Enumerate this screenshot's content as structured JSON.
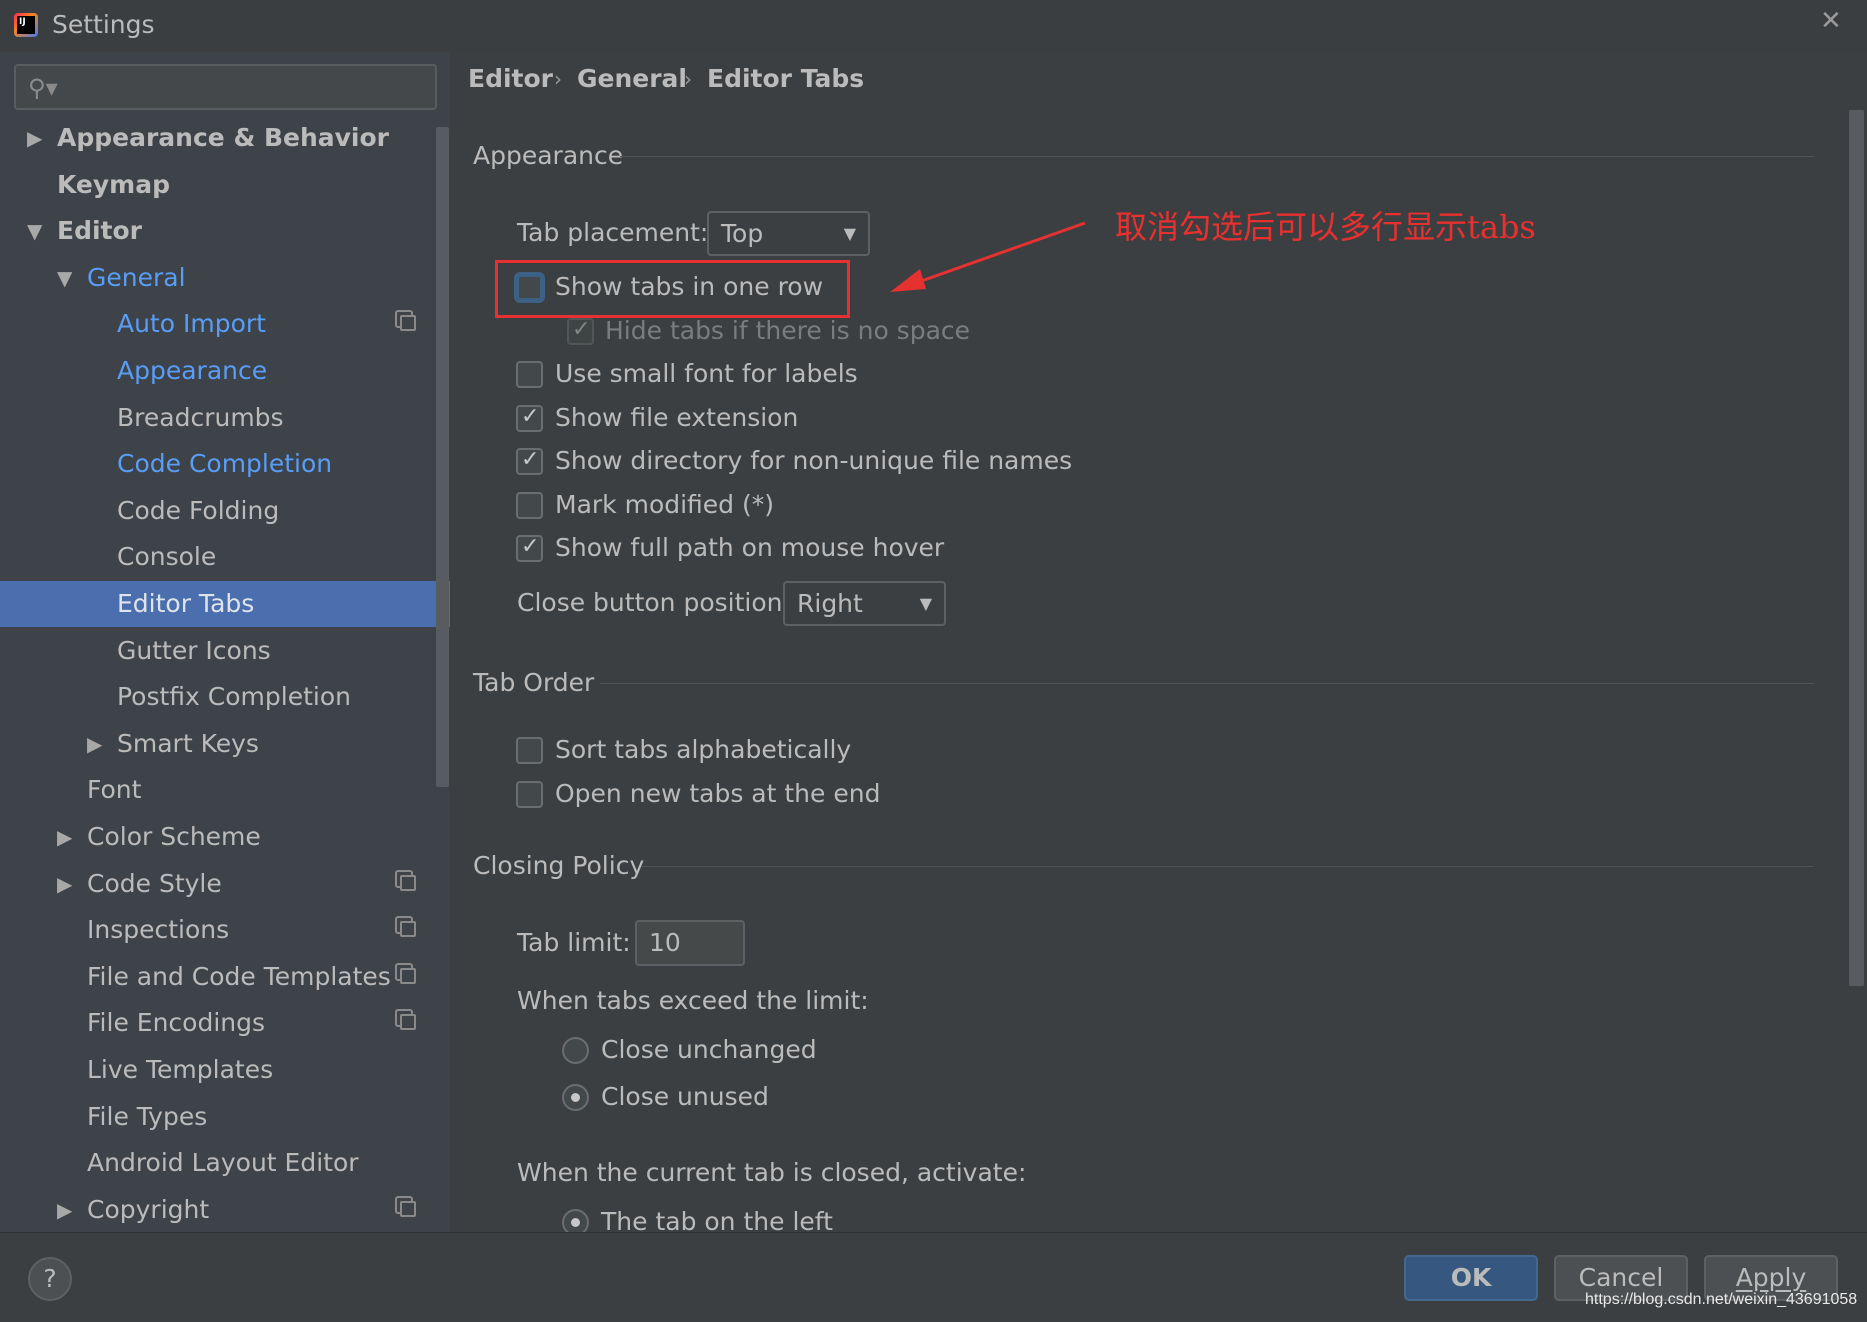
{
  "window": {
    "title": "Settings",
    "app_icon": "intellij-idea-icon",
    "app_icon_text": "IJ"
  },
  "search": {
    "placeholder": "",
    "value": ""
  },
  "colors": {
    "accent": "#4b6eaf",
    "link": "#589df6",
    "annotation": "#e8312f",
    "primary_button": "#365880"
  },
  "tree": [
    {
      "label": "Appearance & Behavior",
      "level": 0,
      "arrow": "collapsed",
      "bold": true
    },
    {
      "label": "Keymap",
      "level": 0,
      "bold": true
    },
    {
      "label": "Editor",
      "level": 0,
      "arrow": "expanded",
      "bold": true
    },
    {
      "label": "General",
      "level": 1,
      "arrow": "expanded",
      "modified": true
    },
    {
      "label": "Auto Import",
      "level": 2,
      "modified": true,
      "project_icon": true
    },
    {
      "label": "Appearance",
      "level": 2,
      "modified": true
    },
    {
      "label": "Breadcrumbs",
      "level": 2
    },
    {
      "label": "Code Completion",
      "level": 2,
      "modified": true
    },
    {
      "label": "Code Folding",
      "level": 2
    },
    {
      "label": "Console",
      "level": 2
    },
    {
      "label": "Editor Tabs",
      "level": 2,
      "selected": true
    },
    {
      "label": "Gutter Icons",
      "level": 2
    },
    {
      "label": "Postfix Completion",
      "level": 2
    },
    {
      "label": "Smart Keys",
      "level": 2,
      "arrow": "collapsed"
    },
    {
      "label": "Font",
      "level": 1
    },
    {
      "label": "Color Scheme",
      "level": 1,
      "arrow": "collapsed"
    },
    {
      "label": "Code Style",
      "level": 1,
      "arrow": "collapsed",
      "project_icon": true
    },
    {
      "label": "Inspections",
      "level": 1,
      "project_icon": true
    },
    {
      "label": "File and Code Templates",
      "level": 1,
      "project_icon": true
    },
    {
      "label": "File Encodings",
      "level": 1,
      "project_icon": true
    },
    {
      "label": "Live Templates",
      "level": 1
    },
    {
      "label": "File Types",
      "level": 1
    },
    {
      "label": "Android Layout Editor",
      "level": 1
    },
    {
      "label": "Copyright",
      "level": 1,
      "arrow": "collapsed",
      "project_icon": true
    }
  ],
  "breadcrumb": [
    "Editor",
    "General",
    "Editor Tabs"
  ],
  "appearance": {
    "heading": "Appearance",
    "tab_placement_label": "Tab placement:",
    "tab_placement_value": "Top",
    "show_one_row": {
      "label": "Show tabs in one row",
      "checked": false
    },
    "hide_no_space": {
      "label": "Hide tabs if there is no space",
      "checked": true,
      "disabled": true
    },
    "small_font": {
      "label": "Use small font for labels",
      "checked": false
    },
    "file_ext": {
      "label": "Show file extension",
      "checked": true
    },
    "directory": {
      "label": "Show directory for non-unique file names",
      "checked": true
    },
    "mark_modified": {
      "label": "Mark modified (*)",
      "checked": false
    },
    "full_path": {
      "label": "Show full path on mouse hover",
      "checked": true
    },
    "close_pos_label": "Close button position:",
    "close_pos_value": "Right"
  },
  "tab_order": {
    "heading": "Tab Order",
    "sort": {
      "label": "Sort tabs alphabetically",
      "checked": false
    },
    "open_end": {
      "label": "Open new tabs at the end",
      "checked": false
    }
  },
  "closing": {
    "heading": "Closing Policy",
    "tab_limit_label": "Tab limit:",
    "tab_limit_value": "10",
    "exceed_label": "When tabs exceed the limit:",
    "close_unchanged": "Close unchanged",
    "close_unused": "Close unused",
    "exceed_selected": "Close unused",
    "activate_label": "When the current tab is closed, activate:",
    "tab_left": "The tab on the left"
  },
  "annotation": {
    "text": "取消勾选后可以多行显示tabs"
  },
  "buttons": {
    "ok": "OK",
    "cancel": "Cancel",
    "apply": "Apply",
    "help": "?"
  },
  "watermark": "https://blog.csdn.net/weixin_43691058"
}
